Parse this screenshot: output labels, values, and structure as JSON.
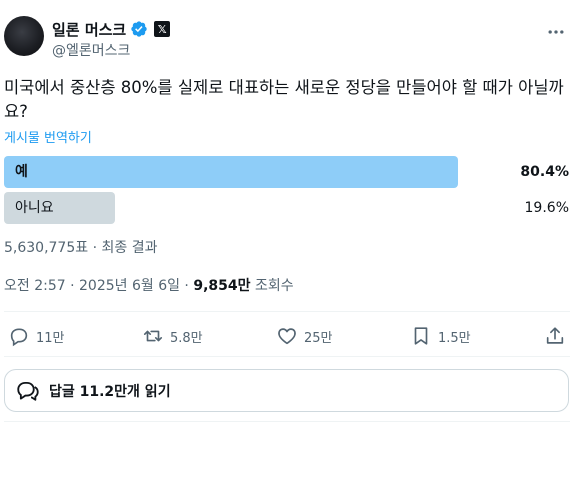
{
  "author": {
    "display_name": "일론 머스크",
    "handle": "@엘론머스크",
    "verified_color": "#1d9bf0",
    "badge_label": "𝕏"
  },
  "tweet": {
    "text": "미국에서 중산층 80%를 실제로 대표하는 새로운 정당을 만들어야 할 때가 아닐까요?",
    "translate_label": "게시물 번역하기"
  },
  "poll": {
    "options": [
      {
        "label": "예",
        "percent_text": "80.4%",
        "percent": 80.4,
        "winner": true
      },
      {
        "label": "아니요",
        "percent_text": "19.6%",
        "percent": 19.6,
        "winner": false
      }
    ],
    "meta": "5,630,775표 · 최종 결과",
    "colors": {
      "winner": "#8ecdf8",
      "other": "#cfd9de"
    }
  },
  "timestamp": {
    "time_date": "오전 2:57 · 2025년 6월 6일 · ",
    "views_count": "9,854만",
    "views_label": " 조회수"
  },
  "actions": {
    "reply_count": "11만",
    "repost_count": "5.8만",
    "like_count": "25만",
    "bookmark_count": "1.5만"
  },
  "replies_button": {
    "label": "답글 11.2만개 읽기"
  }
}
